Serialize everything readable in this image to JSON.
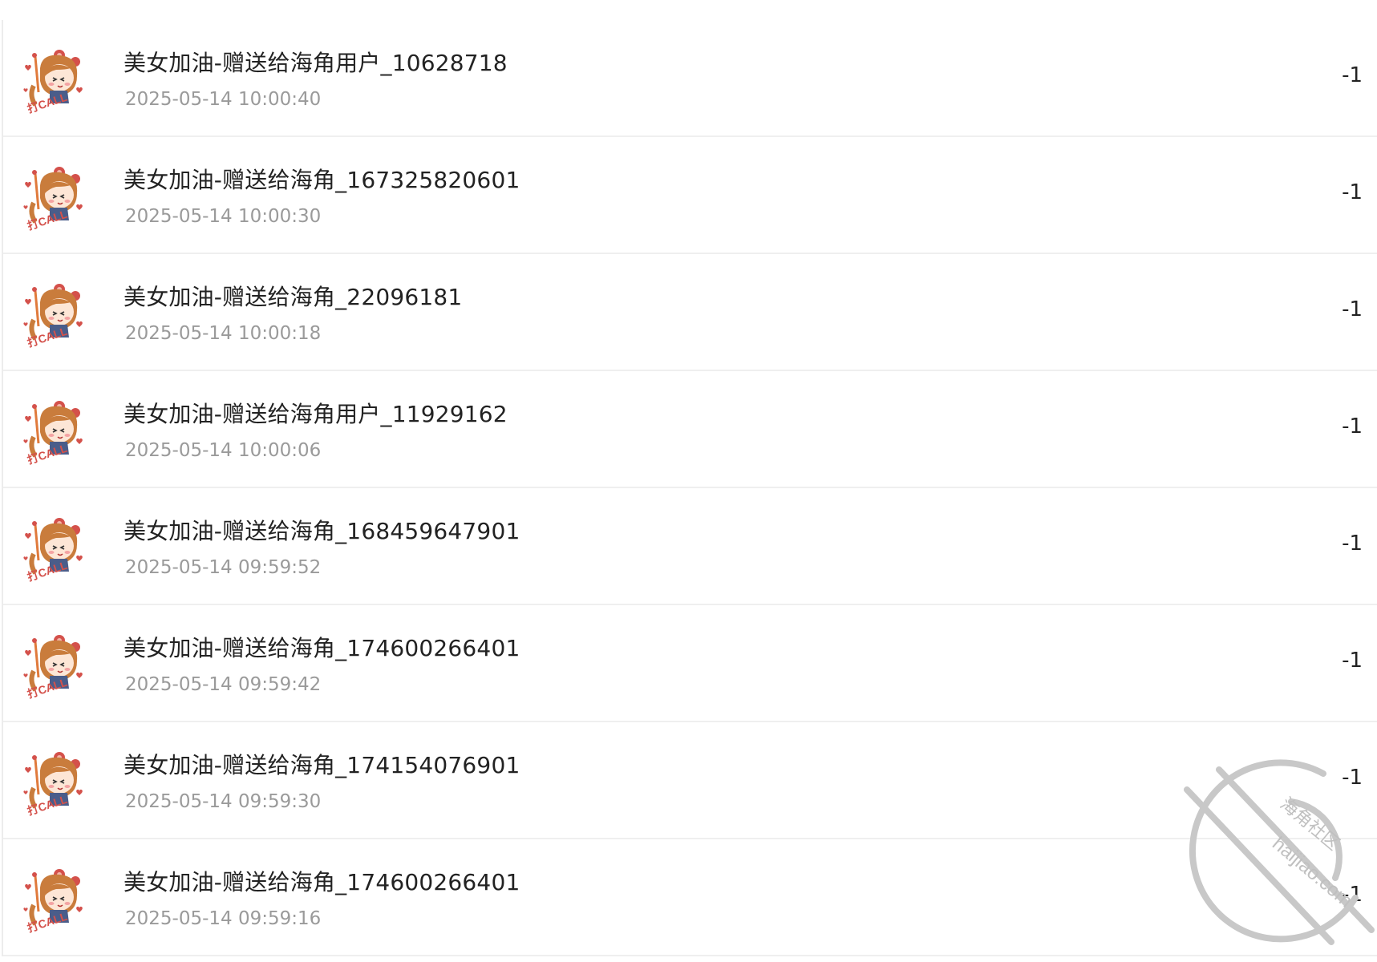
{
  "transactions": [
    {
      "title": "美女加油-赠送给海角用户_10628718",
      "time": "2025-05-14 10:00:40",
      "amount": "-1"
    },
    {
      "title": "美女加油-赠送给海角_167325820601",
      "time": "2025-05-14 10:00:30",
      "amount": "-1"
    },
    {
      "title": "美女加油-赠送给海角_22096181",
      "time": "2025-05-14 10:00:18",
      "amount": "-1"
    },
    {
      "title": "美女加油-赠送给海角用户_11929162",
      "time": "2025-05-14 10:00:06",
      "amount": "-1"
    },
    {
      "title": "美女加油-赠送给海角_168459647901",
      "time": "2025-05-14 09:59:52",
      "amount": "-1"
    },
    {
      "title": "美女加油-赠送给海角_174600266401",
      "time": "2025-05-14 09:59:42",
      "amount": "-1"
    },
    {
      "title": "美女加油-赠送给海角_174154076901",
      "time": "2025-05-14 09:59:30",
      "amount": "-1"
    },
    {
      "title": "美女加油-赠送给海角_174600266401",
      "time": "2025-05-14 09:59:16",
      "amount": "-1"
    }
  ],
  "avatar_icon": "cheer-girl-sticker-icon",
  "watermark": {
    "site": "haijiao.com",
    "name": "海角社区"
  },
  "colors": {
    "title": "#222222",
    "time": "#9a9a9a",
    "divider": "#efefef",
    "watermark": "#c8c8c8"
  }
}
